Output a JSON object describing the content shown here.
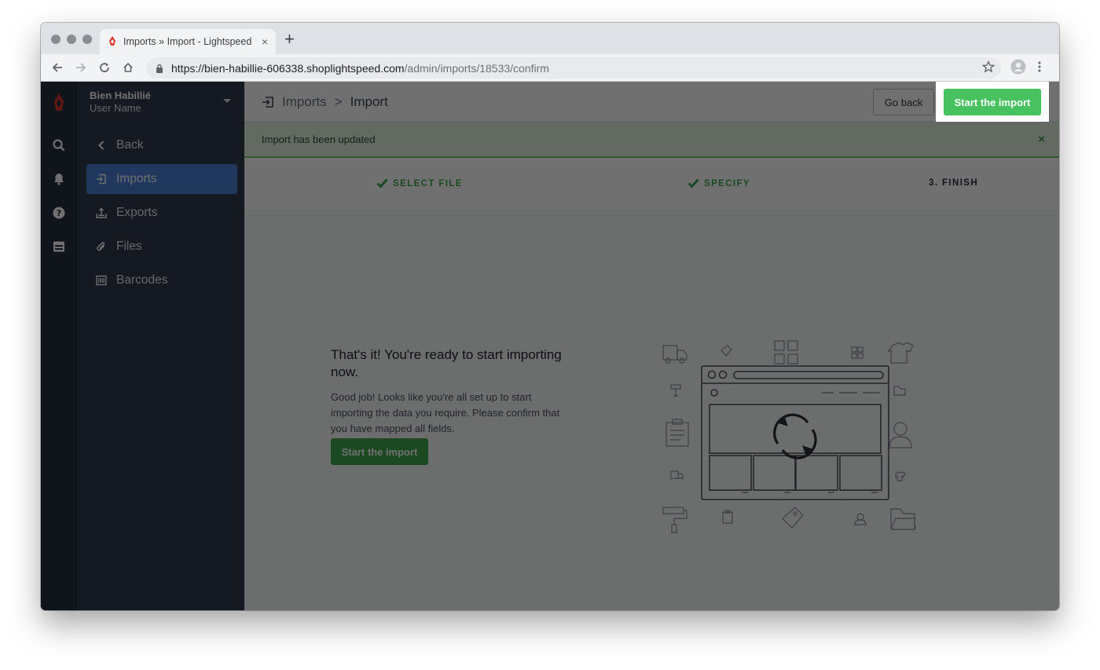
{
  "browser": {
    "tab_title": "Imports » Import - Lightspeed",
    "tab_close": "×",
    "new_tab": "+",
    "url_host": "https://bien-habillie-606338.shoplightspeed.com",
    "url_path": "/admin/imports/18533/confirm"
  },
  "sidebar": {
    "store_name": "Bien Habillié",
    "user_name": "User Name",
    "items": [
      {
        "label": "Back",
        "icon": "chevron-left-icon"
      },
      {
        "label": "Imports",
        "icon": "import-icon",
        "active": true
      },
      {
        "label": "Exports",
        "icon": "export-icon"
      },
      {
        "label": "Files",
        "icon": "paperclip-icon"
      },
      {
        "label": "Barcodes",
        "icon": "barcode-icon"
      }
    ]
  },
  "header": {
    "crumb_parent": "Imports",
    "crumb_sep": ">",
    "crumb_current": "Import",
    "go_back_label": "Go back",
    "start_label": "Start the import"
  },
  "alert": {
    "message": "Import has been updated",
    "close": "×"
  },
  "steps": [
    {
      "label": "SELECT FILE",
      "state": "done"
    },
    {
      "label": "SPECIFY",
      "state": "done"
    },
    {
      "label": "3. FINISH",
      "state": "current"
    }
  ],
  "content": {
    "title": "That's it! You're ready to start importing now.",
    "text": "Good job! Looks like you're all set up to start importing the data you require. Please confirm that you have mapped all fields.",
    "button_label": "Start the import"
  },
  "colors": {
    "accent_green": "#48c261",
    "active_blue": "#4a7ed6",
    "sidebar_dark": "#2e3a4f",
    "brand_red": "#e0352b"
  }
}
